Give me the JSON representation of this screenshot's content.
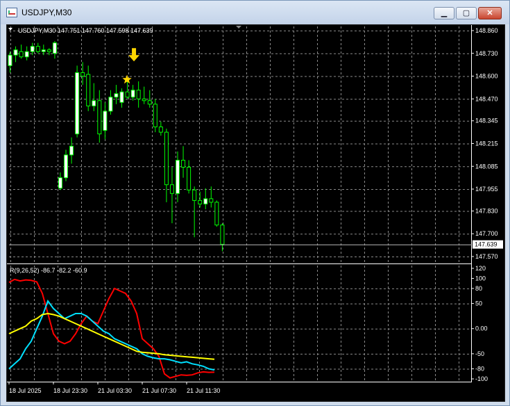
{
  "window": {
    "title": "USDJPY,M30",
    "buttons": {
      "minimize_icon": "minimize-icon",
      "maximize_icon": "maximize-icon",
      "close_icon": "close-icon"
    }
  },
  "main_chart": {
    "info": "USDJPY,M30  147.751 147.760 147.598 147.639",
    "price_ticks": [
      "148.860",
      "148.730",
      "148.600",
      "148.470",
      "148.345",
      "148.215",
      "148.085",
      "147.955",
      "147.830",
      "147.700",
      "147.570"
    ],
    "current_price": "147.639",
    "colors": {
      "bull": "#00ff00",
      "bull_body": "#ffffff",
      "bear": "#00ff00",
      "bear_body": "#000000",
      "marker": "#ffd700"
    },
    "marker_icons": [
      "star-icon",
      "arrow-down-icon"
    ]
  },
  "indicator": {
    "info": "R(9,26,52) -86.7 -82.2 -60.9",
    "ticks": [
      "120",
      "100",
      "80",
      "50",
      "0.00",
      "-50",
      "-80",
      "-100"
    ],
    "levels": [
      80,
      50,
      0,
      -50,
      -80
    ],
    "series_colors": [
      "#ff0000",
      "#00e0ff",
      "#ffff00"
    ]
  },
  "time_axis": [
    "18 Jul 2025",
    "18 Jul 23:30",
    "21 Jul 03:30",
    "21 Jul 07:30",
    "21 Jul 11:30"
  ],
  "chart_data": {
    "type": "candlestick",
    "symbol": "USDJPY",
    "timeframe": "M30",
    "ylim": [
      147.57,
      148.86
    ],
    "candles": [
      {
        "o": 148.66,
        "h": 148.74,
        "l": 148.62,
        "c": 148.72
      },
      {
        "o": 148.72,
        "h": 148.77,
        "l": 148.68,
        "c": 148.75
      },
      {
        "o": 148.74,
        "h": 148.78,
        "l": 148.7,
        "c": 148.71
      },
      {
        "o": 148.71,
        "h": 148.77,
        "l": 148.69,
        "c": 148.74
      },
      {
        "o": 148.74,
        "h": 148.79,
        "l": 148.72,
        "c": 148.77
      },
      {
        "o": 148.77,
        "h": 148.79,
        "l": 148.73,
        "c": 148.74
      },
      {
        "o": 148.74,
        "h": 148.78,
        "l": 148.72,
        "c": 148.75
      },
      {
        "o": 148.75,
        "h": 148.76,
        "l": 148.72,
        "c": 148.74
      },
      {
        "o": 148.73,
        "h": 148.8,
        "l": 148.7,
        "c": 148.79
      },
      {
        "o": 147.96,
        "h": 148.05,
        "l": 147.95,
        "c": 148.02
      },
      {
        "o": 148.02,
        "h": 148.18,
        "l": 148.0,
        "c": 148.15
      },
      {
        "o": 148.15,
        "h": 148.25,
        "l": 148.1,
        "c": 148.2
      },
      {
        "o": 148.27,
        "h": 148.66,
        "l": 148.25,
        "c": 148.62
      },
      {
        "o": 148.62,
        "h": 148.68,
        "l": 148.55,
        "c": 148.6
      },
      {
        "o": 148.61,
        "h": 148.66,
        "l": 148.4,
        "c": 148.43
      },
      {
        "o": 148.43,
        "h": 148.56,
        "l": 148.4,
        "c": 148.46
      },
      {
        "o": 148.46,
        "h": 148.52,
        "l": 148.22,
        "c": 148.27
      },
      {
        "o": 148.29,
        "h": 148.45,
        "l": 148.24,
        "c": 148.4
      },
      {
        "o": 148.4,
        "h": 148.52,
        "l": 148.38,
        "c": 148.48
      },
      {
        "o": 148.48,
        "h": 148.55,
        "l": 148.44,
        "c": 148.5
      },
      {
        "o": 148.45,
        "h": 148.53,
        "l": 148.42,
        "c": 148.51
      },
      {
        "o": 148.51,
        "h": 148.58,
        "l": 148.47,
        "c": 148.48
      },
      {
        "o": 148.48,
        "h": 148.55,
        "l": 148.46,
        "c": 148.52
      },
      {
        "o": 148.52,
        "h": 148.57,
        "l": 148.42,
        "c": 148.47
      },
      {
        "o": 148.47,
        "h": 148.54,
        "l": 148.44,
        "c": 148.46
      },
      {
        "o": 148.46,
        "h": 148.52,
        "l": 148.42,
        "c": 148.44
      },
      {
        "o": 148.44,
        "h": 148.47,
        "l": 148.28,
        "c": 148.31
      },
      {
        "o": 148.31,
        "h": 148.34,
        "l": 148.26,
        "c": 148.28
      },
      {
        "o": 148.28,
        "h": 148.3,
        "l": 147.88,
        "c": 147.98
      },
      {
        "o": 147.98,
        "h": 148.08,
        "l": 147.76,
        "c": 147.93
      },
      {
        "o": 147.93,
        "h": 148.17,
        "l": 147.88,
        "c": 148.12
      },
      {
        "o": 148.12,
        "h": 148.2,
        "l": 148.02,
        "c": 148.08
      },
      {
        "o": 148.08,
        "h": 148.12,
        "l": 147.93,
        "c": 147.95
      },
      {
        "o": 147.95,
        "h": 147.97,
        "l": 147.68,
        "c": 147.89
      },
      {
        "o": 147.89,
        "h": 147.94,
        "l": 147.85,
        "c": 147.87
      },
      {
        "o": 147.87,
        "h": 147.96,
        "l": 147.84,
        "c": 147.9
      },
      {
        "o": 147.9,
        "h": 147.97,
        "l": 147.85,
        "c": 147.88
      },
      {
        "o": 147.88,
        "h": 147.89,
        "l": 147.74,
        "c": 147.75
      },
      {
        "o": 147.75,
        "h": 147.76,
        "l": 147.6,
        "c": 147.64
      }
    ],
    "oscillator": {
      "name": "R(9,26,52)",
      "ylim": [
        -100,
        120
      ],
      "series": [
        {
          "values": [
            92,
            98,
            95,
            97,
            96,
            93,
            70,
            30,
            -10,
            -25,
            -30,
            -25,
            -10,
            10,
            25,
            15,
            10,
            35,
            60,
            80,
            75,
            70,
            55,
            30,
            -20,
            -30,
            -40,
            -55,
            -90,
            -98,
            -95,
            -92,
            -93,
            -92,
            -88,
            -86,
            -87,
            -86.7
          ]
        },
        {
          "values": [
            -80,
            -70,
            -60,
            -40,
            -25,
            0,
            25,
            55,
            40,
            30,
            20,
            25,
            30,
            30,
            25,
            15,
            5,
            -5,
            -10,
            -20,
            -25,
            -30,
            -35,
            -40,
            -50,
            -55,
            -58,
            -60,
            -60,
            -62,
            -65,
            -68,
            -66,
            -70,
            -72,
            -75,
            -80,
            -82.2
          ]
        },
        {
          "values": [
            -10,
            -5,
            0,
            5,
            15,
            20,
            28,
            30,
            28,
            25,
            20,
            15,
            10,
            5,
            0,
            -5,
            -10,
            -15,
            -20,
            -25,
            -30,
            -35,
            -40,
            -45,
            -47,
            -48,
            -49,
            -50,
            -52,
            -53,
            -54,
            -55,
            -56,
            -57,
            -58,
            -59,
            -60,
            -60.9
          ]
        }
      ]
    }
  }
}
